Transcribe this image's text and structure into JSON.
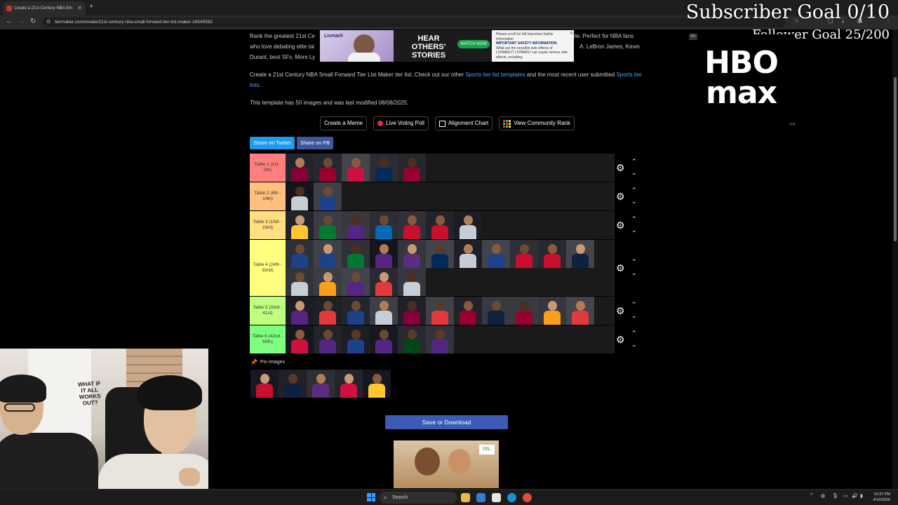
{
  "browser": {
    "tab_title": "Create a 21st Century NBA Sm",
    "url": "tiermaker.com/create/21st-century-nba-small-forward-tier-list-maker-18545592"
  },
  "overlay": {
    "subscriber_goal": "Subscriber Goal 0/10",
    "follower_goal": "Follower Goal 25/200"
  },
  "intro": {
    "line1_a": "Rank the greatest 21st Ce",
    "line1_b": "yle. Perfect for NBA fans",
    "line2_a": "who love debating elite tal",
    "line2_b": "A. LeBron James, Kevin",
    "line3": "Durant, best SFs, More Ly",
    "create_text": "Create a 21st Century NBA Small Forward Tier List Maker tier list. Check out our other ",
    "link_templates": "Sports tier list templates",
    "create_text2": " and the most recent user submitted ",
    "link_lists": "Sports tier lists",
    "create_text3": ".",
    "meta": "This template has 50 images and was last modified 08/06/2025."
  },
  "ad_banner": {
    "brand": "Livmarli",
    "headline": "HEAR OTHERS' STORIES",
    "cta": "WATCH NOW",
    "note": "Please scroll for full Important Safety Information",
    "title": "IMPORTANT SAFETY INFORMATION",
    "body": "What are the possible side effects of LIVMARLI? LIVMARLI can cause serious side effects, including:"
  },
  "actions": {
    "create_meme": "Create a Meme",
    "live_poll": "Live Voting Poll",
    "alignment": "Alignment Chart",
    "community": "View Community Rank"
  },
  "share": {
    "twitter": "Share on Twitter",
    "fb": "Share on FB"
  },
  "tiers": [
    {
      "label": "Table 1 (1st - 5th)",
      "color": "#ff7f7f",
      "count": 5
    },
    {
      "label": "Table 2 (6th - 14th)",
      "color": "#ffbf7f",
      "count": 2
    },
    {
      "label": "Table 3 (15th - 23rd)",
      "color": "#ffdf7f",
      "count": 7
    },
    {
      "label": "Table 4 (24th - 32nd)",
      "color": "#ffff7f",
      "count": 16
    },
    {
      "label": "Table 5 (33rd - 41st)",
      "color": "#bfff7f",
      "count": 11
    },
    {
      "label": "Table 6 (42nd - 50th)",
      "color": "#7fff7f",
      "count": 6
    }
  ],
  "pin": {
    "label": "Pin Images",
    "count": 5
  },
  "save": "Save or Download",
  "side_ad": {
    "tag": "AD",
    "line1": "HBO",
    "line2": "max",
    "footer": "PN"
  },
  "webcam": {
    "shirt_text": "WHAT IF IT ALL WORKS OUT?"
  },
  "taskbar": {
    "search": "Search",
    "time": "10:37 PM",
    "date": "4/16/2026"
  },
  "colors": {
    "accent_link": "#4aa3ff",
    "save_button": "#3b5bb5",
    "twitter": "#1d9bf0",
    "facebook": "#3b5998"
  }
}
